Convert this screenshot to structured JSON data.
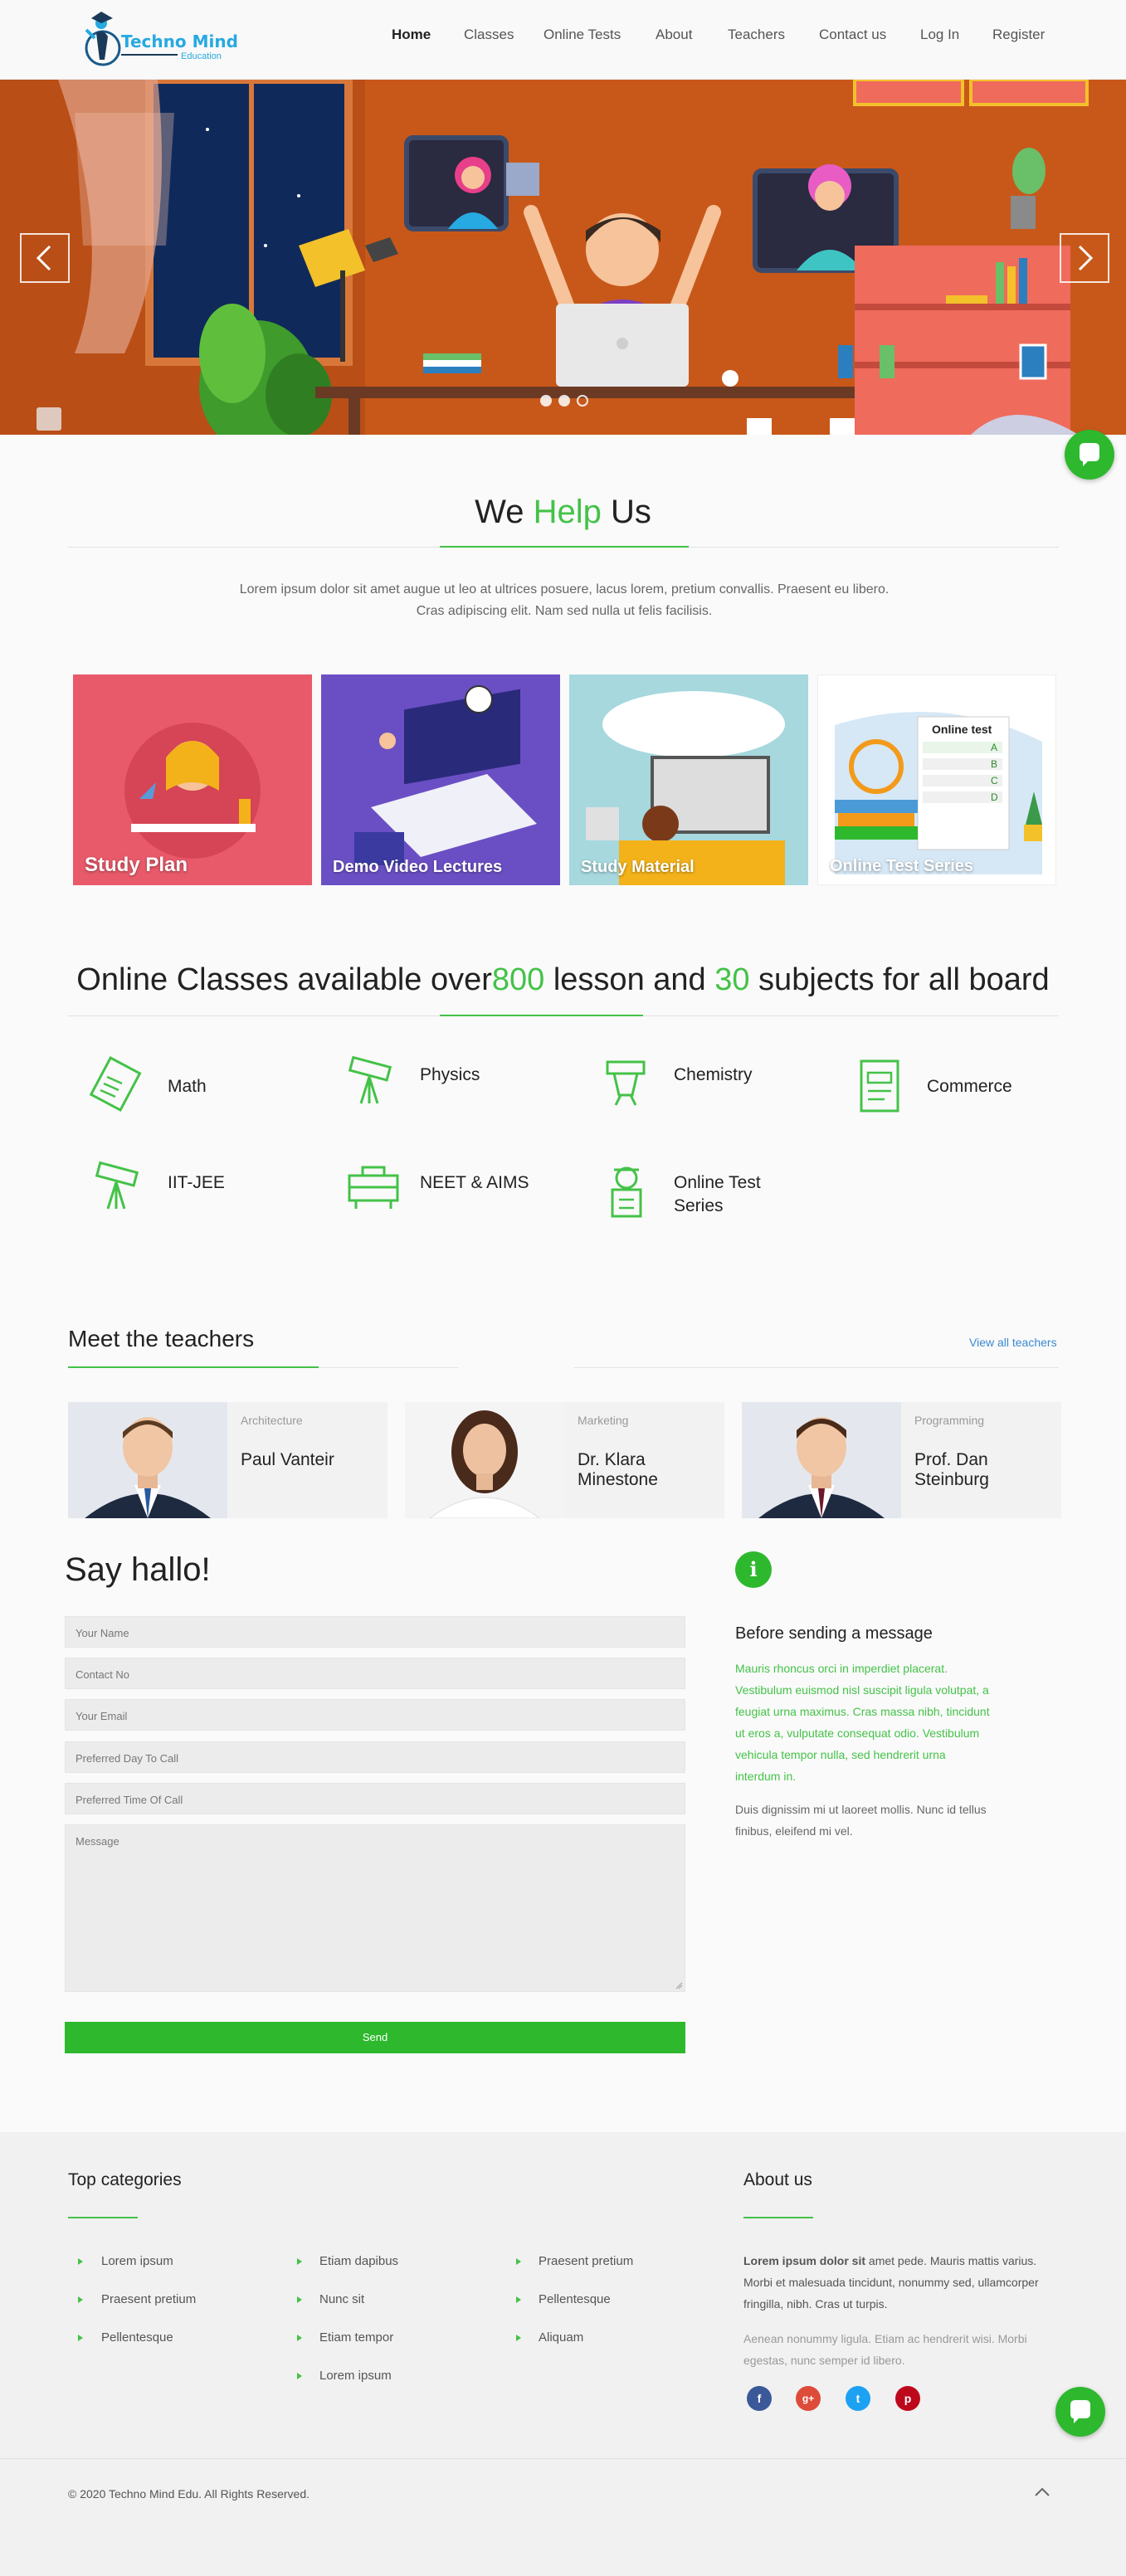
{
  "brand": {
    "name": "Techno Mind",
    "tagline": "Education"
  },
  "nav": [
    {
      "label": "Home",
      "active": true
    },
    {
      "label": "Classes"
    },
    {
      "label": "Online Tests"
    },
    {
      "label": "About"
    },
    {
      "label": "Teachers"
    },
    {
      "label": "Contact us"
    },
    {
      "label": "Log In"
    },
    {
      "label": "Register"
    }
  ],
  "hero": {
    "slides": 3,
    "current": 3,
    "prev_icon": "chevron-left-icon",
    "next_icon": "chevron-right-icon"
  },
  "help": {
    "title_a": "We",
    "title_b": "Help",
    "title_c": "Us",
    "lead": "Lorem ipsum dolor sit amet augue ut leo at ultrices posuere, lacus lorem, pretium convallis. Praesent eu libero. Cras adipiscing elit. Nam sed nulla ut felis facilisis.",
    "cards": [
      {
        "label": "Study Plan"
      },
      {
        "label": "Demo Video Lectures"
      },
      {
        "label": "Study Material"
      },
      {
        "label": "Online Test Series",
        "sheet_title": "Online test",
        "options": [
          "A",
          "B",
          "C",
          "D"
        ]
      }
    ]
  },
  "classes": {
    "title_a": "Online Classes available over",
    "lessons": "800",
    "title_b": " lesson and ",
    "subjects_count": "30",
    "title_c": " subjects for all board",
    "subjects": [
      {
        "label": "Math",
        "icon": "ruler-notebook-icon"
      },
      {
        "label": "Physics",
        "icon": "telescope-icon"
      },
      {
        "label": "Chemistry",
        "icon": "lab-desk-icon"
      },
      {
        "label": "Commerce",
        "icon": "document-icon"
      },
      {
        "label": "IIT-JEE",
        "icon": "telescope-icon"
      },
      {
        "label": "NEET & AIMS",
        "icon": "briefcase-icon"
      },
      {
        "label": "Online Test",
        "label2": "Series",
        "icon": "student-icon"
      }
    ]
  },
  "teachers": {
    "title": "Meet the teachers",
    "view_all": "View all teachers",
    "list": [
      {
        "dept": "Architecture",
        "name": "Paul Vanteir"
      },
      {
        "dept": "Marketing",
        "name": "Dr. Klara Minestone"
      },
      {
        "dept": "Programming",
        "name": "Prof. Dan Steinburg"
      }
    ]
  },
  "contact": {
    "title": "Say hallo!",
    "fields": [
      "Your Name",
      "Contact No",
      "Your Email",
      "Preferred Day To Call",
      "Preferred Time Of Call"
    ],
    "message_placeholder": "Message",
    "send": "Send",
    "info_heading": "Before sending a message",
    "info_green": "Mauris rhoncus orci in imperdiet placerat. Vestibulum euismod nisl suscipit ligula volutpat, a feugiat urna maximus. Cras massa nibh, tincidunt ut eros a, vulputate consequat odio. Vestibulum vehicula tempor nulla, sed hendrerit urna interdum in.",
    "info_gray": "Duis dignissim mi ut laoreet mollis. Nunc id tellus finibus, eleifend mi vel."
  },
  "footer": {
    "categories_title": "Top categories",
    "col1": [
      "Lorem ipsum",
      "Praesent pretium",
      "Pellentesque"
    ],
    "col2": [
      "Etiam dapibus",
      "Nunc sit",
      "Etiam tempor",
      "Lorem ipsum"
    ],
    "col3": [
      "Praesent pretium",
      "Pellentesque",
      "Aliquam"
    ],
    "about_title": "About us",
    "about_bold": "Lorem ipsum dolor sit",
    "about_text": " amet pede. Mauris mattis varius. Morbi et malesuada tincidunt, nonummy sed, ullamcorper fringilla, nibh. Cras ut turpis.",
    "about_muted": "Aenean nonummy ligula. Etiam ac hendrerit wisi. Morbi egestas, nunc semper id libero.",
    "social": [
      {
        "icon": "facebook-icon",
        "glyph": "f",
        "color": "#3b5998"
      },
      {
        "icon": "google-plus-icon",
        "glyph": "g+",
        "color": "#dd4b39"
      },
      {
        "icon": "twitter-icon",
        "glyph": "t",
        "color": "#1da1f2"
      },
      {
        "icon": "pinterest-icon",
        "glyph": "p",
        "color": "#bd081c"
      }
    ],
    "copyright": "© 2020 Techno Mind Edu. All Rights Reserved."
  },
  "colors": {
    "accent": "#44c248",
    "brand": "#27a9e1",
    "hero_bg": "#c85a18"
  }
}
